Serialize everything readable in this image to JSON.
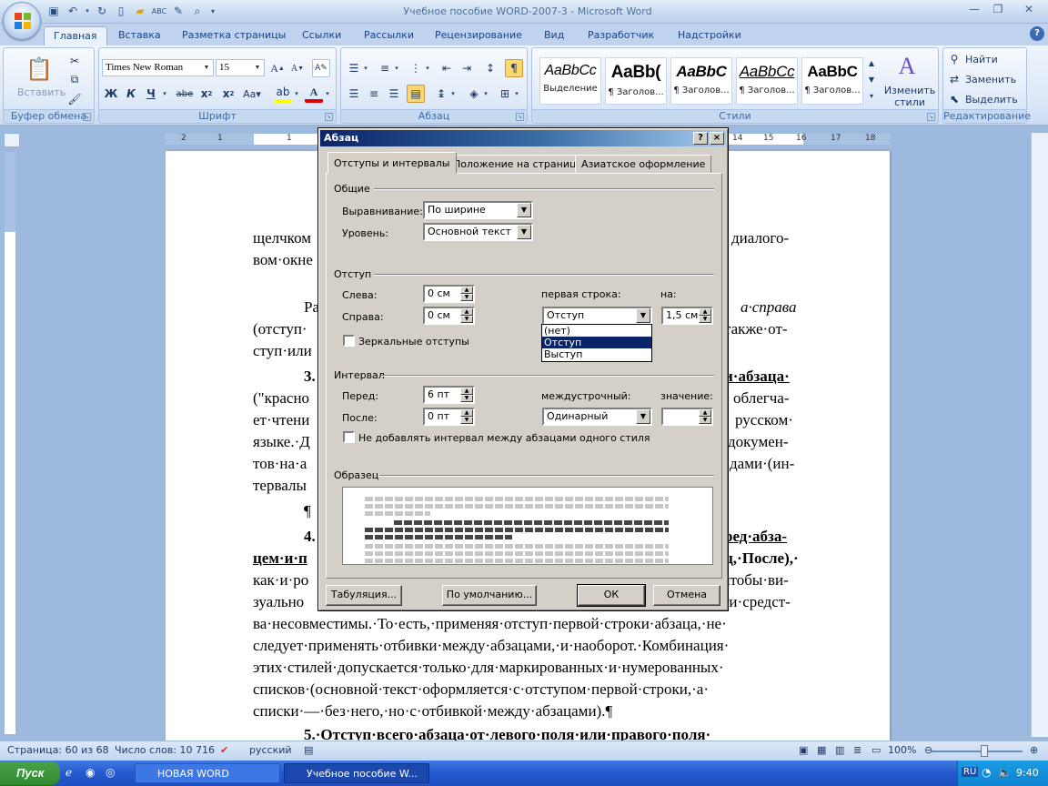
{
  "window": {
    "title": "Учебное пособие WORD-2007-3 - Microsoft Word",
    "controls": [
      "minimize-icon",
      "maximize-icon",
      "close-icon"
    ]
  },
  "ribbon": {
    "tabs": [
      "Главная",
      "Вставка",
      "Разметка страницы",
      "Ссылки",
      "Рассылки",
      "Рецензирование",
      "Вид",
      "Разработчик",
      "Надстройки"
    ],
    "active_tab": "Главная",
    "clipboard": {
      "paste_label": "Вставить",
      "group_label": "Буфер обмена"
    },
    "font": {
      "name": "Times New Roman",
      "size": "15",
      "group_label": "Шрифт",
      "bold": "Ж",
      "italic": "К",
      "underline": "Ч",
      "strike": "abe"
    },
    "paragraph": {
      "group_label": "Абзац"
    },
    "styles": {
      "group_label": "Стили",
      "items": [
        {
          "sample": "AaBbCc",
          "name": "Выделение"
        },
        {
          "sample": "AaBb(",
          "name": "¶ Заголов..."
        },
        {
          "sample": "AaBbC",
          "name": "¶ Заголов..."
        },
        {
          "sample": "AaBbCc",
          "name": "¶ Заголов..."
        },
        {
          "sample": "AaBbC",
          "name": "¶ Заголов..."
        }
      ],
      "change_styles_label": "Изменить стили"
    },
    "editing": {
      "group_label": "Редактирование",
      "find": "Найти",
      "replace": "Заменить",
      "select": "Выделить"
    }
  },
  "ruler": {
    "numbers": [
      "2",
      "1",
      "1",
      "2",
      "14",
      "15",
      "16",
      "17",
      "18"
    ]
  },
  "document": {
    "lines": [
      "щелчком",
      "диалого-",
      "вом·окне",
      "Ра",
      "а·справа",
      "(отступ·",
      "также·от-",
      "ступ·или",
      "3.",
      "и·абзаца·",
      "(\"красно",
      "облегча-",
      "ет·чтени",
      "русском·",
      "языке.·Д",
      "докумен-",
      "тов·на·а",
      "дами·(ин-",
      "тервалы",
      "¶",
      "4.",
      "ред·абза-",
      "цем·и·п",
      "ц,·После),·",
      "как·и·ро",
      "чтобы·ви-",
      "зуально",
      "ти·средст-",
      "ва·несовместимы.·То·есть,·применяя·отступ·первой·строки·абзаца,·не·",
      "следует·применять·отбивки·между·абзацами,·и·наоборот.·Комбинация·",
      "этих·стилей·допускается·только·для·маркированных·и·нумерованных·",
      "списков·(основной·текст·оформляется·с·отступом·первой·строки,·а·",
      "списки·—·без·него,·но·с·отбивкой·между·абзацами).¶",
      "5.·Отступ·всего·абзаца·от·левого·поля·или·правого·поля·"
    ]
  },
  "dialog": {
    "title": "Абзац",
    "help": "?",
    "close": "×",
    "tabs": [
      "Отступы и интервалы",
      "Положение на странице",
      "Азиатское оформление"
    ],
    "active_tab": "Отступы и интервалы",
    "general": {
      "section": "Общие",
      "alignment_label": "Выравнивание:",
      "alignment_value": "По ширине",
      "level_label": "Уровень:",
      "level_value": "Основной текст"
    },
    "indent": {
      "section": "Отступ",
      "left_label": "Слева:",
      "left_value": "0 см",
      "right_label": "Справа:",
      "right_value": "0 см",
      "first_line_label": "первая строка:",
      "first_line_value": "Отступ",
      "by_label": "на:",
      "by_value": "1,5 см",
      "mirror_label": "Зеркальные отступы",
      "options": [
        "(нет)",
        "Отступ",
        "Выступ"
      ],
      "selected_option": "Отступ"
    },
    "spacing": {
      "section": "Интервал",
      "before_label": "Перед:",
      "before_value": "6 пт",
      "after_label": "После:",
      "after_value": "0 пт",
      "line_label": "междустрочный:",
      "line_value": "Одинарный",
      "at_label": "значение:",
      "at_value": "",
      "no_space_label": "Не добавлять интервал между абзацами одного стиля"
    },
    "preview_section": "Образец",
    "buttons": {
      "tabs": "Табуляция...",
      "default": "По умолчанию...",
      "ok": "ОК",
      "cancel": "Отмена"
    }
  },
  "statusbar": {
    "page": "Страница: 60 из 68",
    "words": "Число слов: 10 716",
    "language": "русский",
    "zoom": "100%"
  },
  "taskbar": {
    "start": "Пуск",
    "tasks": [
      "НОВАЯ WORD",
      "Учебное пособие W..."
    ],
    "lang": "RU",
    "clock": "9:40"
  }
}
